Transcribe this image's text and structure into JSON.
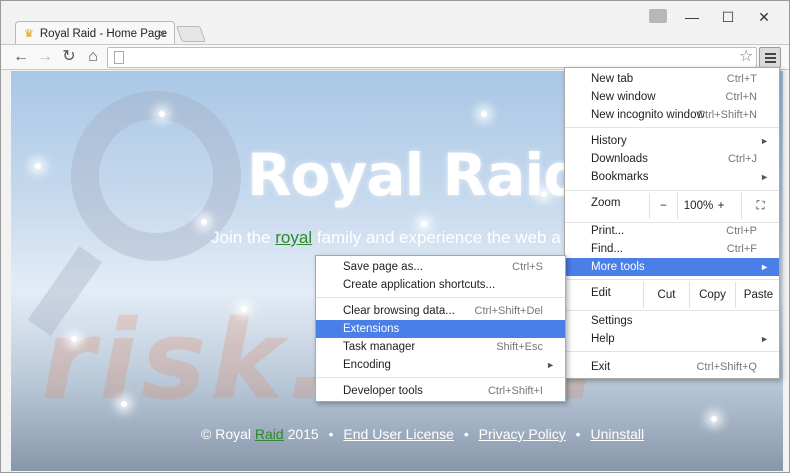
{
  "tab": {
    "title": "Royal Raid - Home Page",
    "close_glyph": "×"
  },
  "window_controls": {
    "minimize": "—",
    "maximize": "☐",
    "close": "✕"
  },
  "toolbar": {
    "back": "←",
    "forward": "→",
    "reload": "↻",
    "home": "⌂",
    "star": "☆"
  },
  "page": {
    "title": "Royal Raid",
    "subtitle_pre": "Join the ",
    "subtitle_accent": "royal",
    "subtitle_post": " family and experience the web a",
    "footer": {
      "copy_pre": "© Royal ",
      "copy_accent": "Raid",
      "copy_post": " 2015",
      "eula": "End User License",
      "privacy": "Privacy Policy",
      "uninstall": "Uninstall",
      "sep": "•"
    },
    "watermark": "risk.com",
    "colors": {
      "accent_green": "#2d8a2b",
      "highlight_blue": "#4a7fe8"
    }
  },
  "menu": {
    "new_tab": {
      "label": "New tab",
      "shortcut": "Ctrl+T"
    },
    "new_window": {
      "label": "New window",
      "shortcut": "Ctrl+N"
    },
    "incognito": {
      "label": "New incognito window",
      "shortcut": "Ctrl+Shift+N"
    },
    "history": {
      "label": "History"
    },
    "downloads": {
      "label": "Downloads",
      "shortcut": "Ctrl+J"
    },
    "bookmarks": {
      "label": "Bookmarks"
    },
    "zoom": {
      "label": "Zoom",
      "minus": "−",
      "value": "100%",
      "plus": "+",
      "fullscreen": "⛶"
    },
    "print": {
      "label": "Print...",
      "shortcut": "Ctrl+P"
    },
    "find": {
      "label": "Find...",
      "shortcut": "Ctrl+F"
    },
    "more_tools": {
      "label": "More tools"
    },
    "edit": {
      "label": "Edit",
      "cut": "Cut",
      "copy": "Copy",
      "paste": "Paste"
    },
    "settings": {
      "label": "Settings"
    },
    "help": {
      "label": "Help"
    },
    "exit": {
      "label": "Exit",
      "shortcut": "Ctrl+Shift+Q"
    },
    "arrow": "►"
  },
  "submenu": {
    "save_page": {
      "label": "Save page as...",
      "shortcut": "Ctrl+S"
    },
    "app_shortcuts": {
      "label": "Create application shortcuts..."
    },
    "clear_data": {
      "label": "Clear browsing data...",
      "shortcut": "Ctrl+Shift+Del"
    },
    "extensions": {
      "label": "Extensions"
    },
    "task_manager": {
      "label": "Task manager",
      "shortcut": "Shift+Esc"
    },
    "encoding": {
      "label": "Encoding"
    },
    "dev_tools": {
      "label": "Developer tools",
      "shortcut": "Ctrl+Shift+I"
    }
  }
}
